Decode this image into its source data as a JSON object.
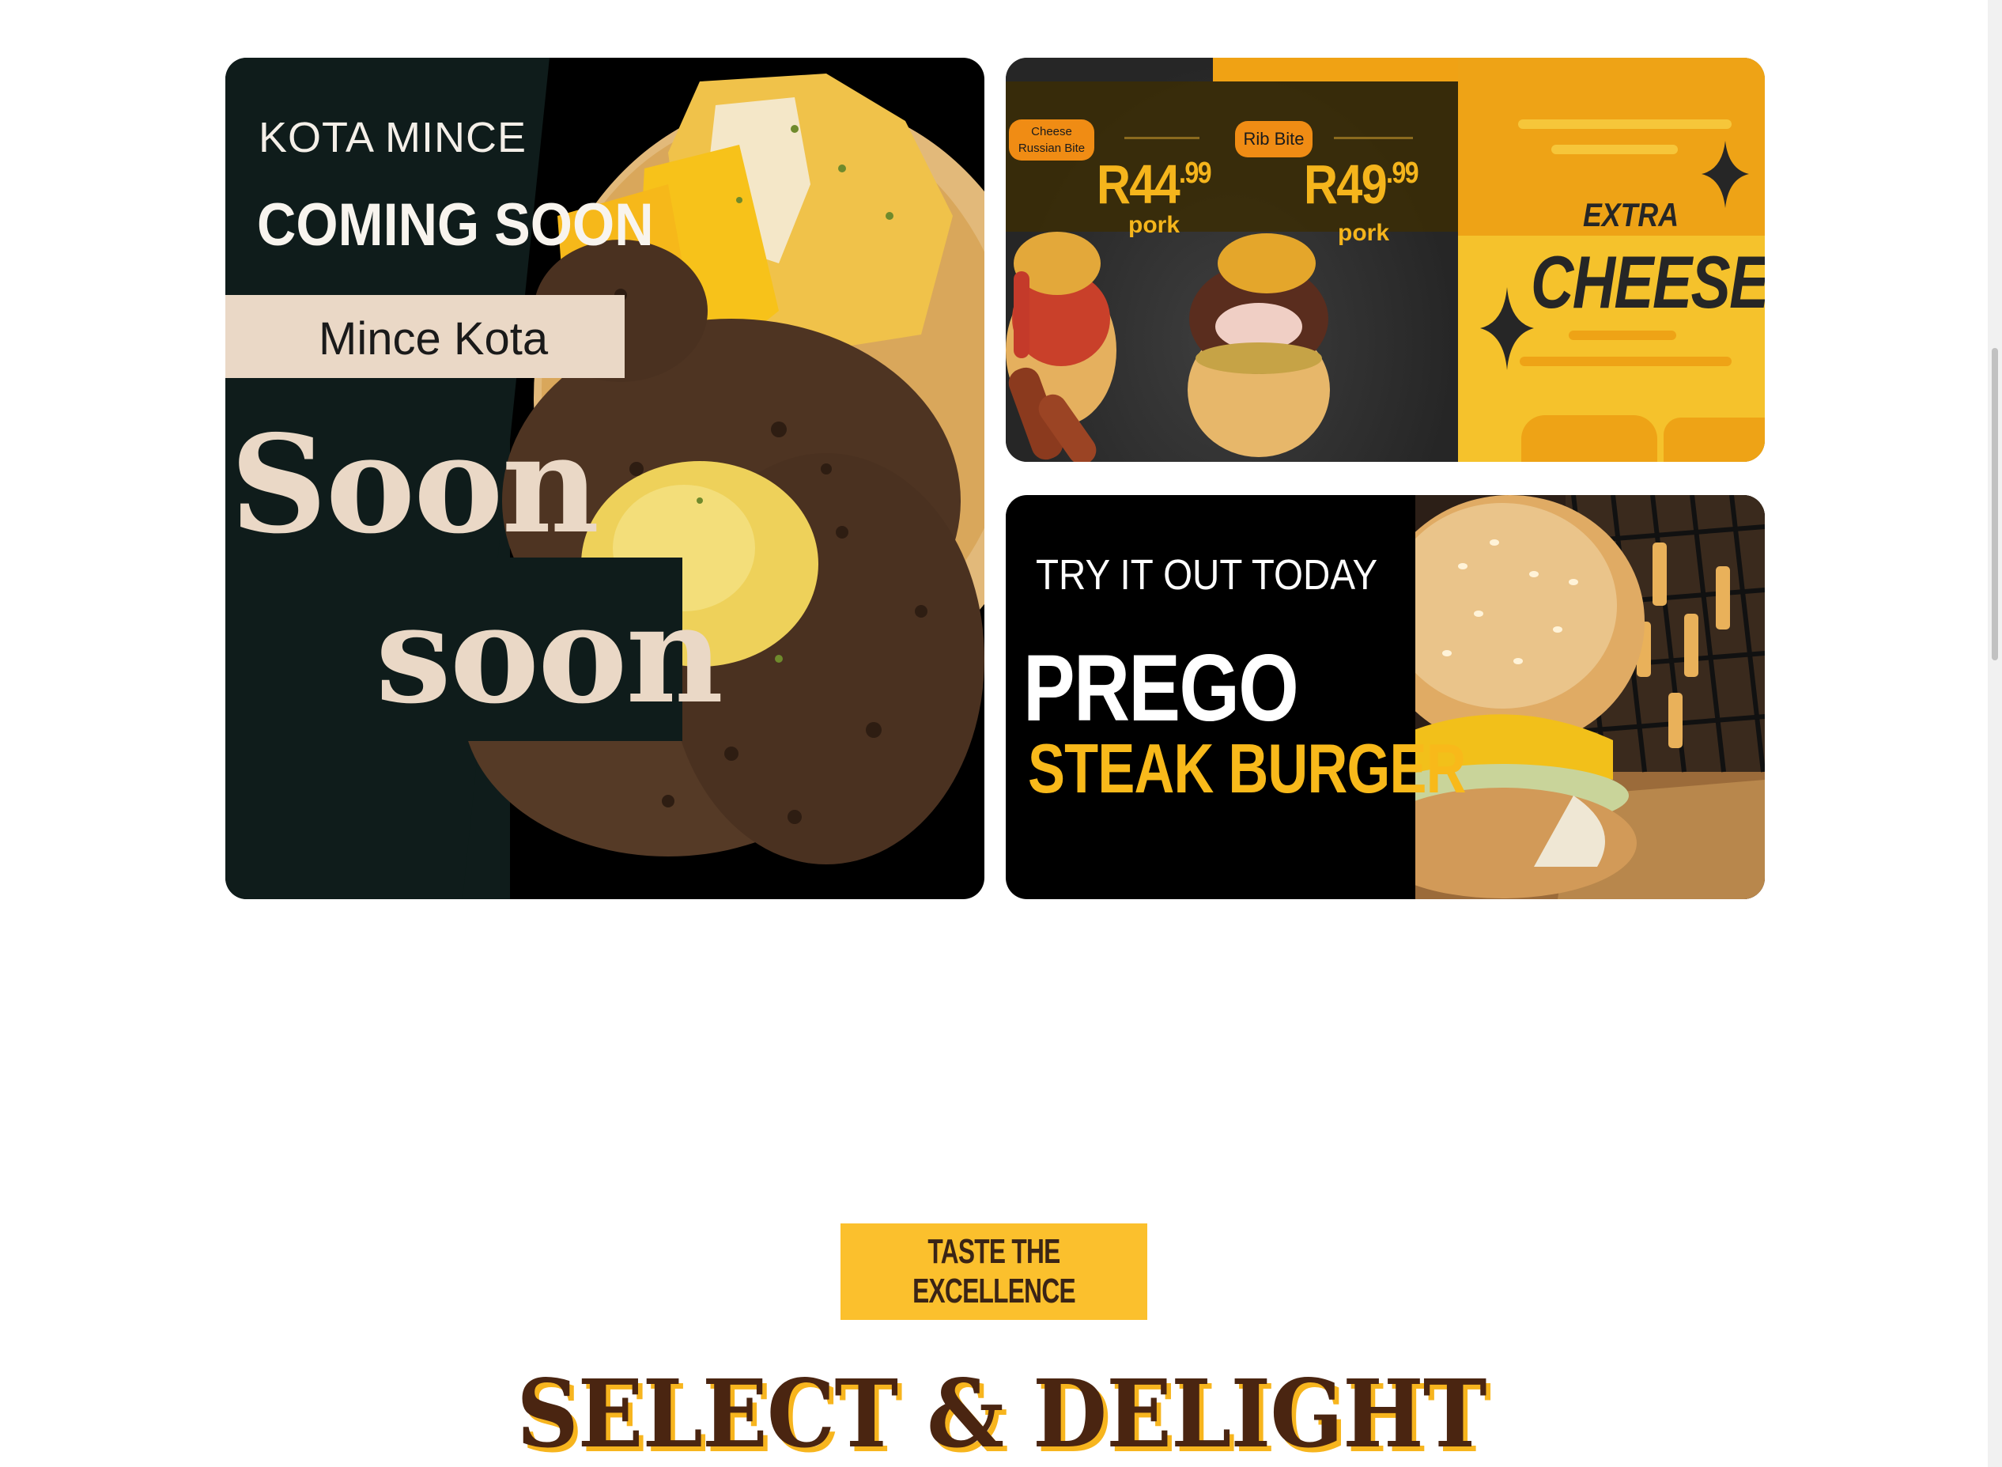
{
  "banners": {
    "kota": {
      "small": "KOTA MINCE",
      "big": "COMING SOON",
      "tag": "Mince Kota",
      "soon1": "Soon",
      "soon2": "soon"
    },
    "bites": {
      "item1_label_line1": "Cheese",
      "item1_label_line2": "Russian Bite",
      "item1_price": "R44",
      "item1_cents": ".99",
      "item1_meat": "pork",
      "item2_label": "Rib Bite",
      "item2_price": "R49",
      "item2_cents": ".99",
      "item2_meat": "pork",
      "extra": "EXTRA",
      "cheese": "CHEESE"
    },
    "prego": {
      "try": "TRY IT OUT TODAY",
      "title": "PREGO",
      "subtitle": "STEAK BURGER"
    }
  },
  "cta": {
    "button_label": "TASTE THE EXCELLENCE"
  },
  "section": {
    "headline": "SELECT & DELIGHT"
  },
  "colors": {
    "accent_yellow": "#fbc02d",
    "brown": "#4a2511",
    "dark_teal": "#0f1c1b",
    "cream": "#ead8c6"
  }
}
